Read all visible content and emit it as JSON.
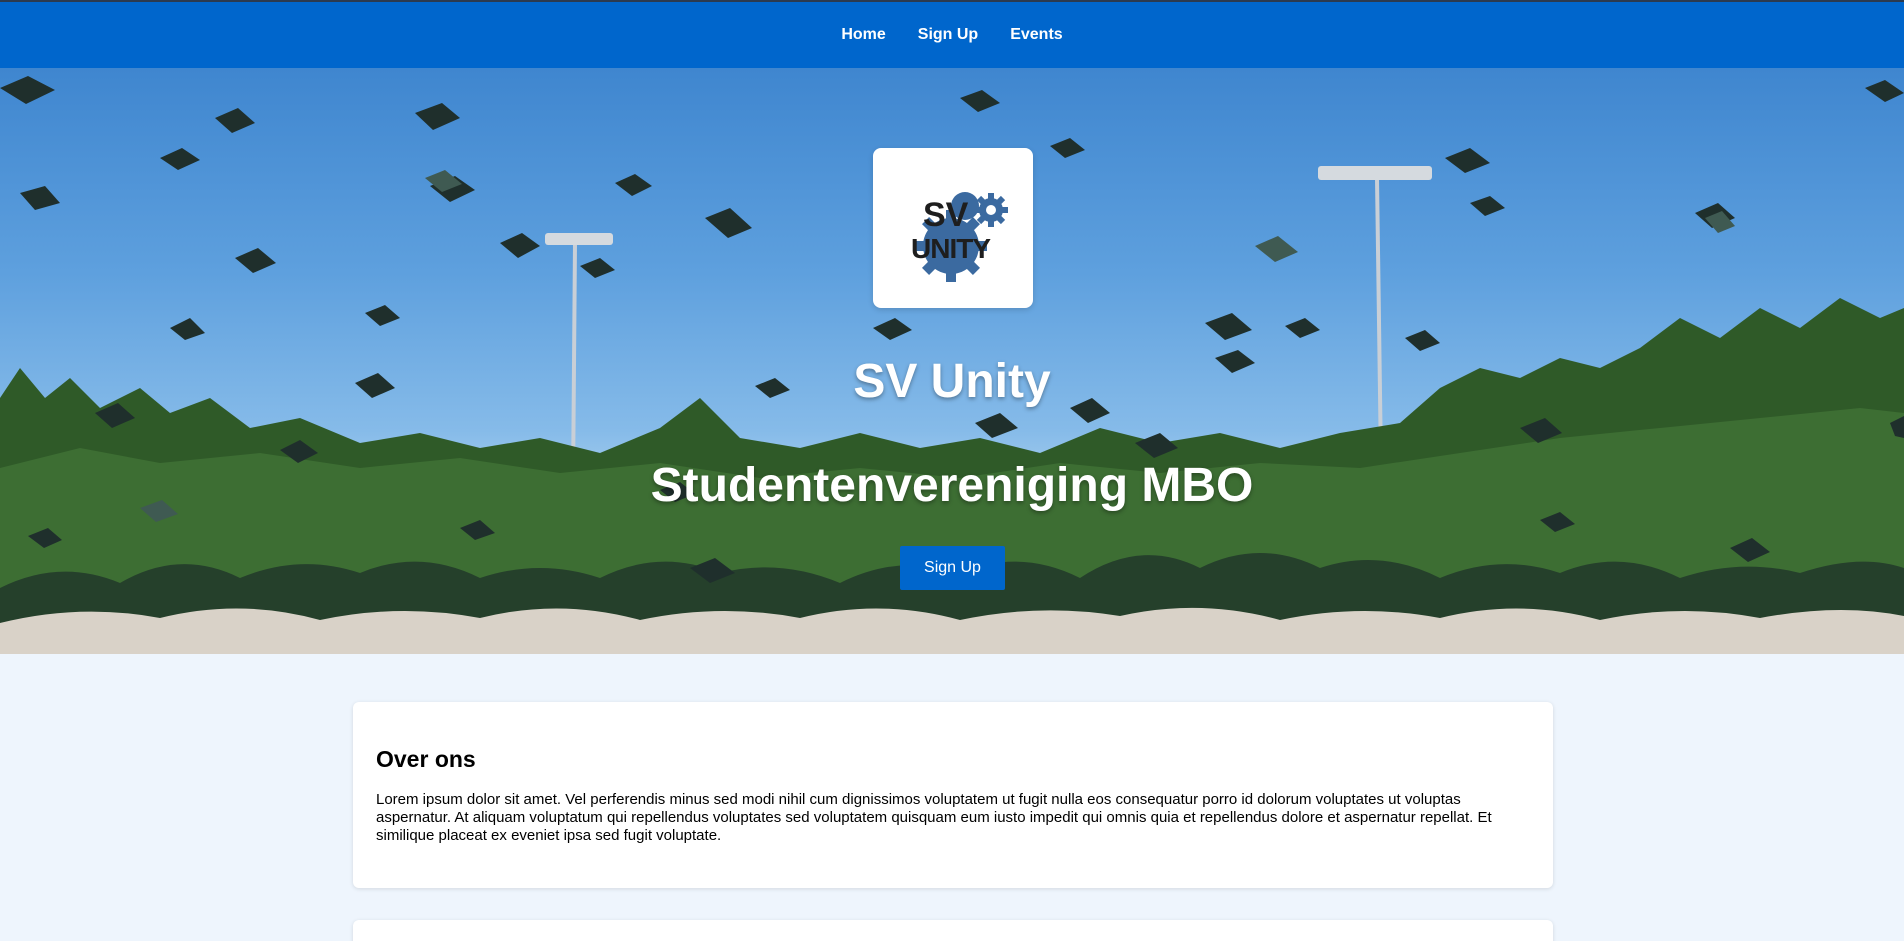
{
  "nav": {
    "items": [
      {
        "label": "Home"
      },
      {
        "label": "Sign Up"
      },
      {
        "label": "Events"
      }
    ]
  },
  "hero": {
    "logo_text_line1": "SV",
    "logo_text_line2": "UNITY",
    "title": "SV Unity",
    "subtitle": "Studentenvereniging MBO",
    "button_label": "Sign Up"
  },
  "about": {
    "heading": "Over ons",
    "body": "Lorem ipsum dolor sit amet. Vel perferendis minus sed modi nihil cum dignissimos voluptatem ut fugit nulla eos consequatur porro id dolorum voluptates ut voluptas aspernatur. At aliquam voluptatum qui repellendus voluptates sed voluptatem quisquam eum iusto impedit qui omnis quia et repellendus dolore et aspernatur repellat. Et similique placeat ex eveniet ipsa sed fugit voluptate."
  },
  "colors": {
    "accent": "#0066cc",
    "page_background": "#eef5fd"
  }
}
